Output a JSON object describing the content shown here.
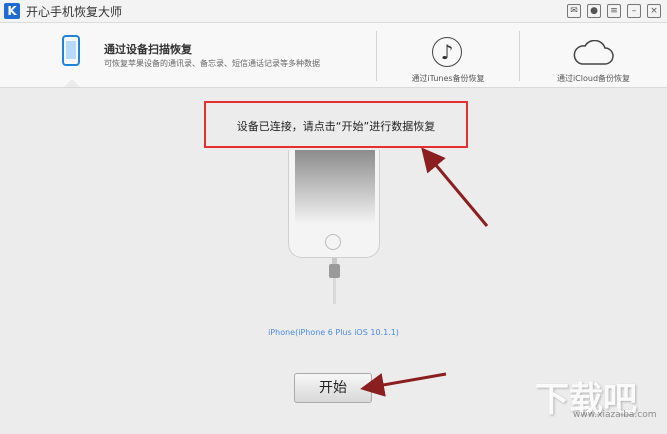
{
  "window": {
    "logo": "K",
    "title": "开心手机恢复大师"
  },
  "nav": {
    "scan": {
      "title": "通过设备扫描恢复",
      "desc": "可恢复苹果设备的通讯录、备忘录、短信通话记录等多种数据"
    },
    "itunes": {
      "label": "通过iTunes备份恢复",
      "icon": "music-note-icon"
    },
    "icloud": {
      "label": "通过iCloud备份恢复",
      "icon": "cloud-icon"
    }
  },
  "status": {
    "message": "设备已连接，请点击“开始”进行数据恢复"
  },
  "device": {
    "label": "iPhone(iPhone 6 Plus iOS 10.1.1)"
  },
  "actions": {
    "start_label": "开始"
  },
  "watermark": {
    "brand": "下载吧",
    "url": "www.xiazaiba.com"
  },
  "colors": {
    "accent": "#1e84dc",
    "highlight": "#e53030",
    "arrow": "#8b1f1f"
  }
}
